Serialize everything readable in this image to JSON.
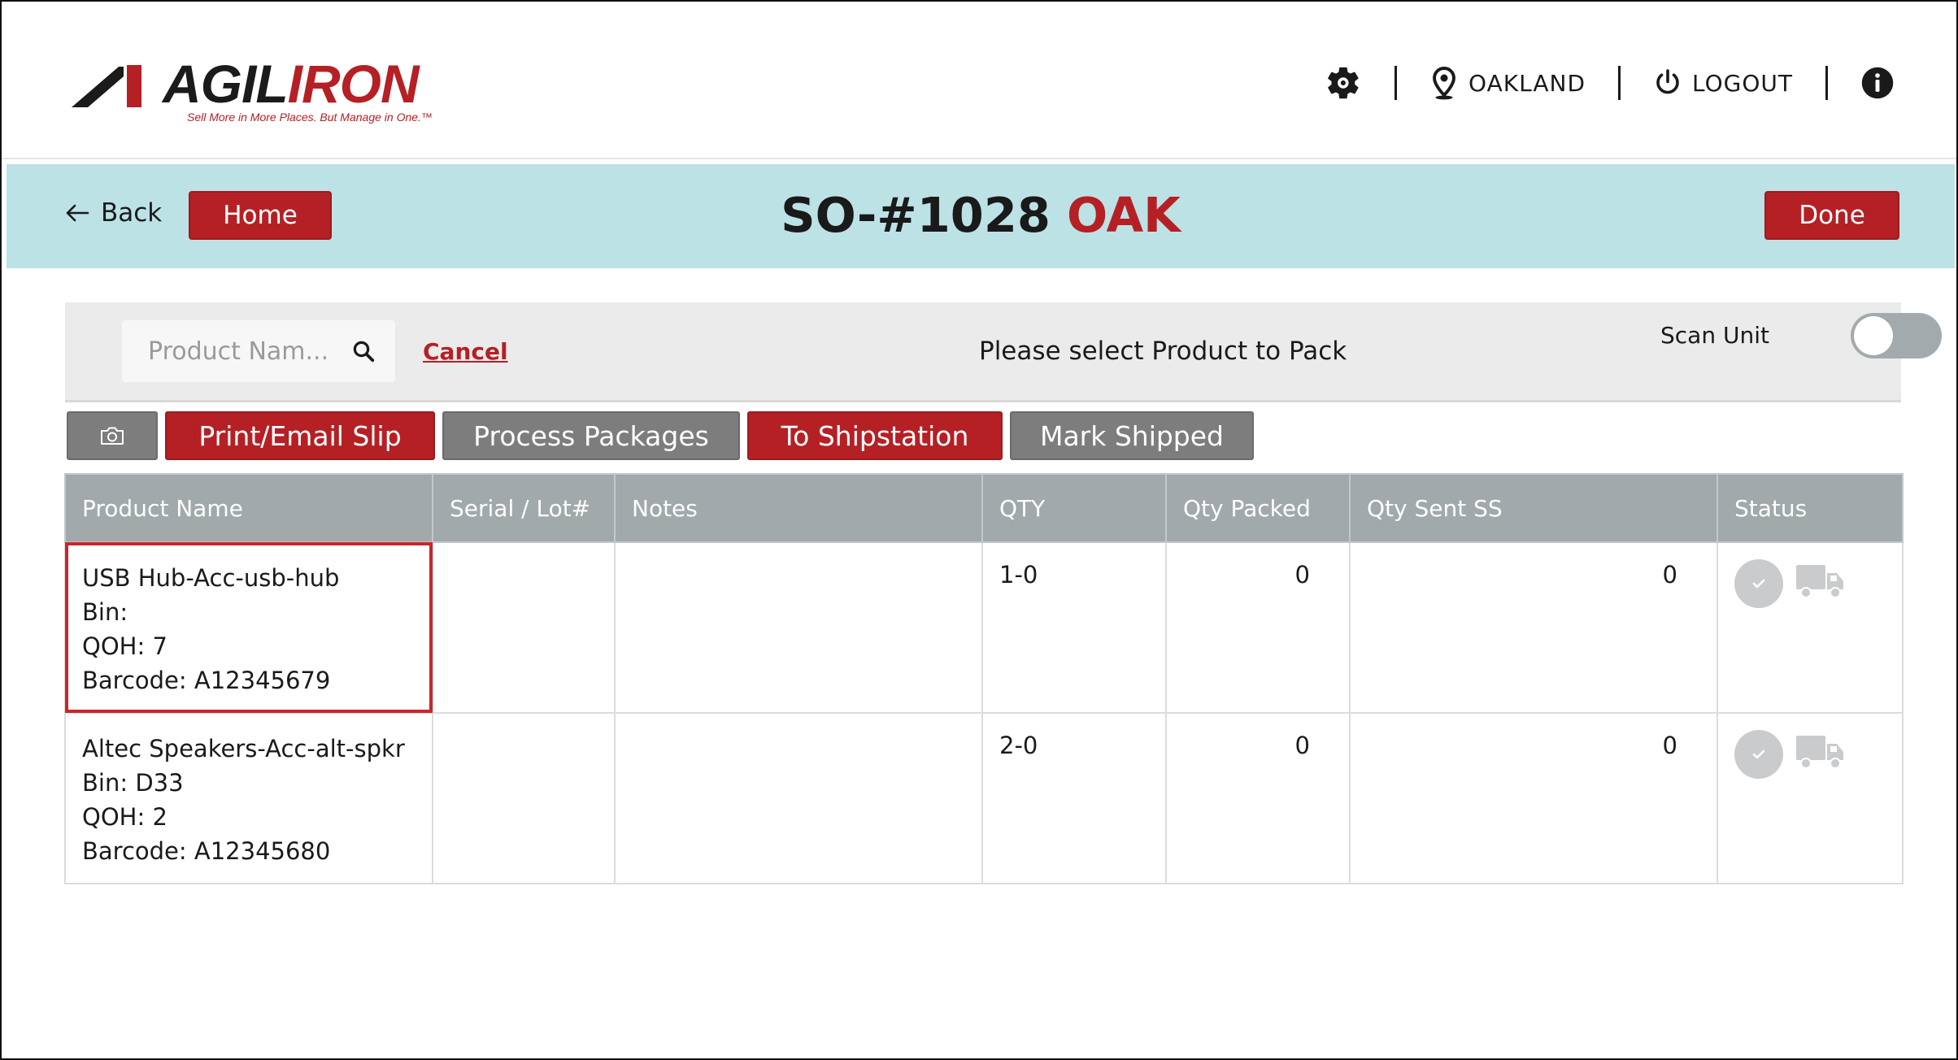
{
  "brand": {
    "name_dark": "AGIL",
    "name_red": "IRON",
    "tagline": "Sell More in More Places. But Manage in One.™"
  },
  "header": {
    "location": "OAKLAND",
    "logout": "LOGOUT"
  },
  "titlebar": {
    "back": "Back",
    "home": "Home",
    "title_main": "SO-#1028",
    "title_accent": "OAK",
    "done": "Done"
  },
  "search": {
    "placeholder": "Product Nam...",
    "cancel": "Cancel",
    "prompt": "Please select Product to Pack",
    "scan_unit_label": "Scan Unit",
    "scan_unit_on": false
  },
  "actions": {
    "print": "Print/Email Slip",
    "process": "Process Packages",
    "shipstation": "To Shipstation",
    "mark_shipped": "Mark Shipped"
  },
  "table": {
    "columns": [
      "Product Name",
      "Serial / Lot#",
      "Notes",
      "QTY",
      "Qty Packed",
      "Qty Sent SS",
      "Status"
    ],
    "rows": [
      {
        "name": "USB Hub-Acc-usb-hub",
        "bin": "Bin:",
        "qoh": "QOH: 7",
        "barcode": "Barcode: A12345679",
        "serial": "",
        "notes": "",
        "qty": "1-0",
        "packed": "0",
        "sent": "0",
        "selected": true
      },
      {
        "name": "Altec Speakers-Acc-alt-spkr",
        "bin": "Bin: D33",
        "qoh": "QOH: 2",
        "barcode": "Barcode: A12345680",
        "serial": "",
        "notes": "",
        "qty": "2-0",
        "packed": "0",
        "sent": "0",
        "selected": false
      }
    ]
  },
  "colors": {
    "accent_red": "#b52025",
    "titlebar_bg": "#bce2e6",
    "table_header": "#a1a9ab"
  }
}
